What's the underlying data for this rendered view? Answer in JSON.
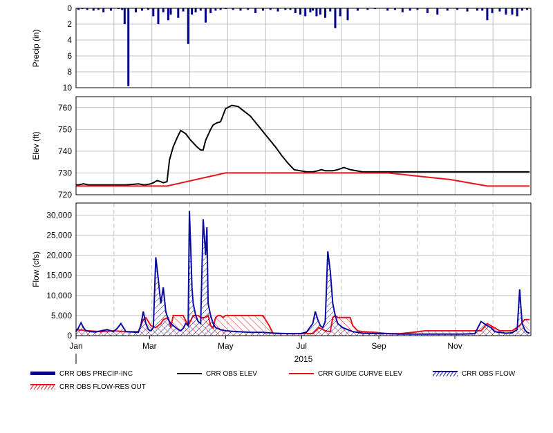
{
  "x_axis": {
    "months": [
      "Jan",
      "Mar",
      "May",
      "Jul",
      "Sep",
      "Nov"
    ],
    "year_label": "2015"
  },
  "colors": {
    "precip": "#00008b",
    "elev": "#000000",
    "guide": "#e8111b",
    "flow": "#0a0aa0",
    "flow_res_out": "#e8111b",
    "grid": "#c0c0c0"
  },
  "legend": [
    {
      "label": "CRR OBS PRECIP-INC",
      "style": "thick-bar",
      "color": "#00008b"
    },
    {
      "label": "CRR OBS ELEV",
      "style": "line",
      "color": "#000000"
    },
    {
      "label": "CRR GUIDE CURVE ELEV",
      "style": "line",
      "color": "#e8111b"
    },
    {
      "label": "CRR OBS FLOW",
      "style": "hatch",
      "color": "#0a0aa0"
    },
    {
      "label": "CRR OBS FLOW-RES OUT",
      "style": "hatch",
      "color": "#e8111b"
    }
  ],
  "chart_data": [
    {
      "type": "bar",
      "ylabel": "Precip (in)",
      "ylim": [
        0,
        10
      ],
      "y_inverted": true,
      "yticks": [
        "0",
        "2",
        "4",
        "6",
        "8",
        "10"
      ],
      "x_unit": "day of year 2015",
      "series": [
        {
          "name": "CRR OBS PRECIP-INC",
          "x": [
            2,
            5,
            9,
            14,
            18,
            22,
            28,
            34,
            37,
            39,
            42,
            48,
            53,
            58,
            62,
            66,
            70,
            74,
            76,
            82,
            86,
            90,
            93,
            96,
            100,
            104,
            108,
            112,
            116,
            120,
            126,
            132,
            138,
            144,
            150,
            156,
            162,
            168,
            172,
            176,
            180,
            184,
            188,
            190,
            193,
            196,
            200,
            204,
            208,
            212,
            218,
            226,
            234,
            240,
            250,
            256,
            262,
            268,
            274,
            282,
            290,
            298,
            306,
            314,
            322,
            326,
            330,
            334,
            340,
            345,
            350,
            354,
            358,
            362
          ],
          "values": [
            0.2,
            0.1,
            0.2,
            0.3,
            0.2,
            0.5,
            0.3,
            0.1,
            0.2,
            2.0,
            9.8,
            0.5,
            0.3,
            0.2,
            1.0,
            2.0,
            0.5,
            1.5,
            0.8,
            1.2,
            0.4,
            4.5,
            0.8,
            0.5,
            0.3,
            1.8,
            0.6,
            0.3,
            0.2,
            0.1,
            0.2,
            0.3,
            0.2,
            0.6,
            0.3,
            0.2,
            0.4,
            0.2,
            0.2,
            0.6,
            0.8,
            1.0,
            0.5,
            0.3,
            1.0,
            0.8,
            1.2,
            0.4,
            2.5,
            1.0,
            1.5,
            0.3,
            0.2,
            0.1,
            0.3,
            0.2,
            0.5,
            0.3,
            0.2,
            0.6,
            0.8,
            0.3,
            0.2,
            0.4,
            0.3,
            0.3,
            1.5,
            0.6,
            0.4,
            0.8,
            0.8,
            1.0,
            0.3,
            0.2
          ]
        }
      ]
    },
    {
      "type": "line",
      "ylabel": "Elev (ft)",
      "ylim": [
        720,
        765
      ],
      "yticks": [
        "720",
        "730",
        "740",
        "750",
        "760"
      ],
      "x_unit": "day of year 2015",
      "series": [
        {
          "name": "CRR OBS ELEV",
          "x": [
            0,
            2,
            6,
            10,
            20,
            30,
            40,
            50,
            55,
            60,
            62,
            65,
            68,
            70,
            73,
            75,
            78,
            81,
            84,
            88,
            92,
            97,
            100,
            102,
            104,
            108,
            110,
            113,
            116,
            120,
            125,
            130,
            140,
            150,
            160,
            165,
            170,
            175,
            180,
            185,
            190,
            194,
            197,
            200,
            203,
            206,
            210,
            215,
            220,
            230,
            240,
            250,
            260,
            270,
            280,
            290,
            300,
            310,
            320,
            325,
            330,
            335,
            340,
            345,
            350,
            355,
            360,
            364
          ],
          "values": [
            724.5,
            724.5,
            725.0,
            724.5,
            724.5,
            724.5,
            724.5,
            725.0,
            724.5,
            725.0,
            725.5,
            726.5,
            726.0,
            725.5,
            726.0,
            736.0,
            742.0,
            746.0,
            749.5,
            748.0,
            745.0,
            742.0,
            740.5,
            740.5,
            745.0,
            750.0,
            752.0,
            753.0,
            753.5,
            759.5,
            761.0,
            760.5,
            756.0,
            749.0,
            742.0,
            738.0,
            734.5,
            731.5,
            731.0,
            730.5,
            730.5,
            731.0,
            731.5,
            731.0,
            731.0,
            731.0,
            731.5,
            732.5,
            731.5,
            730.5,
            730.5,
            730.5,
            730.5,
            730.5,
            730.5,
            730.5,
            730.5,
            730.5,
            730.5,
            730.5,
            730.5,
            730.5,
            730.5,
            730.5,
            730.5,
            730.5,
            730.5,
            730.5
          ],
          "_note_unused": ""
        },
        {
          "name": "CRR GUIDE CURVE ELEV",
          "x": [
            0,
            73,
            120,
            250,
            300,
            330,
            364
          ],
          "values": [
            724.0,
            724.0,
            730.0,
            730.0,
            727.0,
            724.0,
            724.0
          ]
        }
      ]
    },
    {
      "type": "area",
      "ylabel": "Flow (cfs)",
      "ylim": [
        0,
        33000
      ],
      "yticks": [
        "0",
        "5,000",
        "10,000",
        "15,000",
        "20,000",
        "25,000",
        "30,000"
      ],
      "x_unit": "day of year 2015",
      "series": [
        {
          "name": "CRR OBS FLOW",
          "x": [
            0,
            2,
            4,
            6,
            8,
            12,
            16,
            20,
            25,
            30,
            33,
            36,
            40,
            45,
            50,
            52,
            54,
            56,
            58,
            60,
            62,
            64,
            66,
            68,
            70,
            72,
            74,
            76,
            78,
            80,
            82,
            84,
            86,
            88,
            90,
            91,
            92,
            93,
            94,
            96,
            98,
            100,
            102,
            104,
            105,
            106,
            108,
            110,
            112,
            116,
            120,
            130,
            140,
            150,
            160,
            170,
            180,
            185,
            190,
            192,
            194,
            196,
            198,
            200,
            202,
            204,
            206,
            208,
            210,
            214,
            218,
            222,
            226,
            230,
            240,
            250,
            260,
            270,
            280,
            290,
            300,
            310,
            320,
            325,
            330,
            333,
            336,
            340,
            345,
            350,
            354,
            356,
            357,
            358,
            360,
            362,
            364
          ],
          "values": [
            1000,
            2000,
            3200,
            2000,
            1200,
            1000,
            900,
            1200,
            1500,
            1000,
            1800,
            3000,
            1000,
            900,
            800,
            2500,
            6000,
            3000,
            1500,
            1200,
            2000,
            19500,
            14000,
            8000,
            12000,
            6000,
            4000,
            3000,
            2500,
            2000,
            1500,
            1200,
            1800,
            3000,
            2500,
            31000,
            22000,
            12000,
            8000,
            5000,
            3500,
            3000,
            29000,
            20000,
            27000,
            8000,
            5000,
            3000,
            2000,
            1500,
            1200,
            1000,
            800,
            800,
            600,
            500,
            500,
            900,
            3000,
            6000,
            4000,
            2500,
            2000,
            3500,
            21000,
            16000,
            8000,
            5000,
            3000,
            2000,
            1500,
            1000,
            800,
            600,
            500,
            500,
            400,
            400,
            400,
            400,
            400,
            400,
            500,
            3500,
            2500,
            2000,
            1000,
            800,
            600,
            700,
            1500,
            11500,
            7000,
            3000,
            1500,
            800,
            600
          ]
        },
        {
          "name": "CRR OBS FLOW-RES OUT",
          "x": [
            0,
            10,
            20,
            30,
            40,
            50,
            52,
            54,
            56,
            60,
            64,
            68,
            70,
            74,
            76,
            78,
            82,
            86,
            90,
            94,
            98,
            100,
            104,
            106,
            108,
            110,
            112,
            114,
            116,
            118,
            120,
            124,
            130,
            140,
            150,
            155,
            158,
            162,
            170,
            180,
            190,
            195,
            200,
            204,
            206,
            208,
            210,
            212,
            216,
            220,
            222,
            226,
            230,
            240,
            250,
            260,
            270,
            280,
            290,
            300,
            310,
            320,
            325,
            330,
            340,
            350,
            356,
            360,
            364
          ],
          "values": [
            1500,
            1200,
            1000,
            1200,
            1000,
            1000,
            2500,
            4000,
            4500,
            2500,
            2000,
            3000,
            4000,
            4500,
            2000,
            5000,
            5000,
            5000,
            2500,
            5000,
            5000,
            4500,
            4500,
            5000,
            2500,
            2000,
            4500,
            5000,
            5000,
            4500,
            5000,
            5000,
            5000,
            5000,
            5000,
            2500,
            600,
            500,
            500,
            500,
            500,
            2000,
            1200,
            1000,
            4500,
            5000,
            4500,
            4500,
            4500,
            4500,
            2500,
            1200,
            1000,
            800,
            500,
            500,
            800,
            1200,
            1200,
            1200,
            1200,
            1200,
            1200,
            3000,
            1200,
            1200,
            2500,
            4000,
            4000
          ]
        }
      ]
    }
  ]
}
